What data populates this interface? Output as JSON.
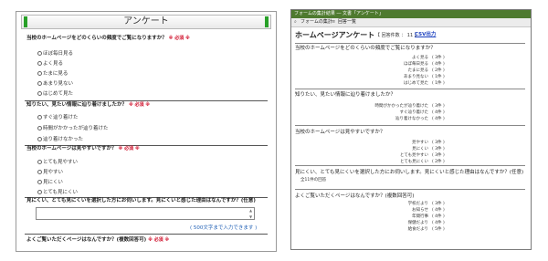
{
  "left": {
    "title": "アンケート",
    "required_mark": "※ 必須 ※",
    "q1": {
      "text": "当校のホームページをどのくらいの頻度でご覧になりますか？",
      "options": [
        "ほぼ毎日見る",
        "よく見る",
        "たまに見る",
        "あまり見ない",
        "はじめて見た"
      ]
    },
    "q2": {
      "text": "知りたい、見たい情報に辿り着けましたか？",
      "options": [
        "すぐ辿り着けた",
        "時間がかかったが辿り着けた",
        "辿り着けなかった"
      ]
    },
    "q3": {
      "text": "当校のホームページは見やすいですか？",
      "options": [
        "とても見やすい",
        "見やすい",
        "見にくい",
        "とても見にくい"
      ]
    },
    "q4": {
      "text": "見にくい、とても見にくいを選択した方にお伺いします。見にくいと感じた理由はなんですか？(任意)",
      "textarea_value": "",
      "char_note": "( 500文字まで入力できます )"
    },
    "q5": {
      "text": "よくご覧いただくページはなんですか？(複数回答可)"
    }
  },
  "right": {
    "window_title": "フォームの集計結果 ― 文書「アンケート」",
    "toolbar": {
      "aggregate": "フォームの集計",
      "responses": "回答一覧"
    },
    "title": "ホームページアンケート",
    "count": "【 回答件数 ： 11 】",
    "csv": "CSV出力",
    "q1": {
      "text": "当校のホームページをどのくらいの頻度でご覧になりますか？",
      "rows": [
        {
          "label": "よく見る",
          "count": "( 3件 )"
        },
        {
          "label": "ほぼ毎日見る",
          "count": "( 4件 )"
        },
        {
          "label": "たまに見る",
          "count": "( 2件 )"
        },
        {
          "label": "あまり見ない",
          "count": "( 1件 )"
        },
        {
          "label": "はじめて見た",
          "count": "( 1件 )"
        }
      ]
    },
    "q2": {
      "text": "知りたい、見たい情報に辿り着けましたか？",
      "rows": [
        {
          "label": "時間がかかったが辿り着けた",
          "count": "( 3件 )"
        },
        {
          "label": "すぐ辿り着けた",
          "count": "( 4件 )"
        },
        {
          "label": "辿り着けなかった",
          "count": "( 4件 )"
        }
      ]
    },
    "q3": {
      "text": "当校のホームページは見やすいですか？",
      "rows": [
        {
          "label": "見やすい",
          "count": "( 3件 )"
        },
        {
          "label": "見にくい",
          "count": "( 3件 )"
        },
        {
          "label": "とても見やすい",
          "count": "( 3件 )"
        },
        {
          "label": "とても見にくい",
          "count": "( 2件 )"
        }
      ]
    },
    "q4": {
      "text": "見にくい、とても見にくいを選択した方にお伺いします。見にくいと感じた理由はなんですか？(任意)",
      "note": "全11件の回答"
    },
    "q5": {
      "text": "よくご覧いただくページはなんですか？(複数回答可)",
      "rows": [
        {
          "label": "学校だより",
          "count": "( 3件 )"
        },
        {
          "label": "お知らせ",
          "count": "( 4件 )"
        },
        {
          "label": "年間行事",
          "count": "( 4件 )"
        },
        {
          "label": "保健だより",
          "count": "( 4件 )"
        },
        {
          "label": "給食だより",
          "count": "( 5件 )"
        }
      ]
    }
  }
}
